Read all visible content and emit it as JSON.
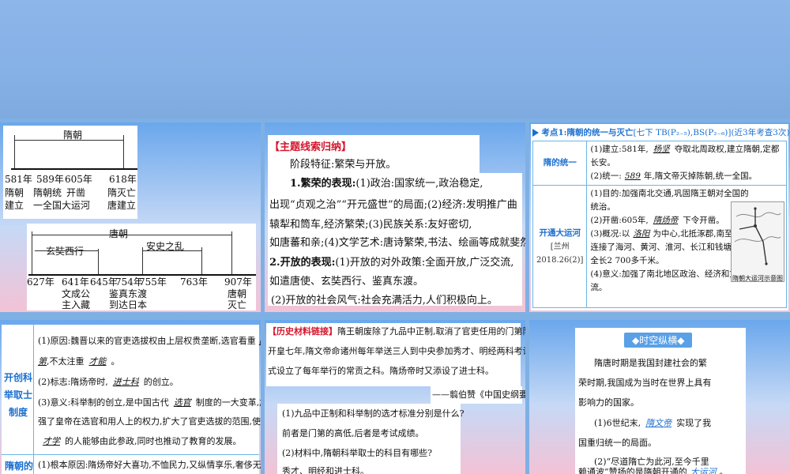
{
  "slide1": {
    "sui_dynasty": "隋朝",
    "tang_dynasty": "唐朝",
    "xuanzang_label": "玄奘西行",
    "anshi_label": "安史之乱",
    "sui_events": [
      {
        "year": "581年",
        "lines": [
          "隋朝",
          "建立"
        ]
      },
      {
        "year": "589年",
        "lines": [
          "隋朝统",
          "一全国"
        ]
      },
      {
        "year": "605年",
        "lines": [
          "开凿",
          "大运河"
        ]
      },
      {
        "year": "618年",
        "lines": [
          "隋灭亡",
          "唐建立"
        ]
      }
    ],
    "tang_events": [
      {
        "year": "627年",
        "lines": []
      },
      {
        "year": "641年",
        "lines": [
          "文成公",
          "主入藏"
        ]
      },
      {
        "year": "645年",
        "lines": []
      },
      {
        "year": "754年",
        "lines": [
          "鉴真东渡",
          "到达日本"
        ]
      },
      {
        "year": "755年",
        "lines": []
      },
      {
        "year": "763年",
        "lines": []
      },
      {
        "year": "907年",
        "lines": [
          "唐朝",
          "灭亡"
        ]
      }
    ]
  },
  "slide2": {
    "title": "【主题线索归纳】",
    "stage": "阶段特征:繁荣与开放。",
    "p1_label": "1.繁荣的表现:",
    "p1_a": "(1)政治:国家统一,政治稳定,",
    "p1_b": "出现“贞观之治”“开元盛世”的局面;(2)经济:发明推广曲",
    "p1_c": "辕犁和筒车,经济繁荣;(3)民族关系:友好密切,",
    "p1_d": "如唐蕃和亲;(4)文学艺术:唐诗繁荣,书法、绘画等成就斐然。",
    "p2_label": "2.开放的表现:",
    "p2_a": "(1)开放的对外政策:全面开放,广泛交流,",
    "p2_b": "如遣唐使、玄奘西行、鉴真东渡。",
    "p2_c": "(2)开放的社会风气:社会充满活力,人们积极向上。"
  },
  "slide3": {
    "header": "考点1:隋朝的统一与灭亡",
    "header_ref": "[七下 TB(P₂₋₅),BS(P₂₋₆)](近3年考查3次)",
    "row1_label": "隋的统一",
    "row1_a1": "(1)建立:581年,",
    "row1_a_blank": "杨坚",
    "row1_a2": "夺取北周政权,建立隋朝,定都长安。",
    "row1_b1": "(2)统一:",
    "row1_b_blank": "589",
    "row1_b2": "年,隋文帝灭掉陈朝,统一全国。",
    "row2_label": "开通大运河",
    "row2_ref": "[兰州2018.26(2)]",
    "row2_1": "(1)目的:加强南北交通,巩固隋王朝对全国的",
    "row2_1b": "统治。",
    "row2_2a": "(2)开凿:605年,",
    "row2_2_blank": "隋炀帝",
    "row2_2b": "下令开凿。",
    "row2_3a": "(3)概况:以",
    "row2_3_blank": "洛阳",
    "row2_3b": "为中心,北抵涿郡,南至余杭,",
    "row2_3c": "连接了海河、黄河、淮河、长江和钱塘江五大水系,",
    "row2_3d": "全长2 700多千米。",
    "row2_4": "(4)意义:加强了南北地区政治、经济和文化交",
    "row2_4b": "流。",
    "map_caption": "隋朝大运河示意图"
  },
  "slide4": {
    "row1_label": "开创科举取士制度",
    "l1a": "(1)原因:魏晋以来的官吏选拔权由上层权贵垄断,选官看重",
    "l1_blank1": "门",
    "l1b_blank": "第",
    "l1b": ",不太注重",
    "l1b_blank2": "才能",
    "l1b_end": "。",
    "l2a": "(2)标志:隋炀帝时,",
    "l2_blank": "进士科",
    "l2b": "的创立。",
    "l3a": "(3)意义:科举制的创立,是中国古代",
    "l3_blank": "选官",
    "l3b": "制度的一大变革,加",
    "l3c": "强了皇帝在选官和用人上的权力,扩大了官吏选拔的范围,使有",
    "l3d_blank": "才学",
    "l3d": "的人能够由此参政,同时也推动了教育的发展。",
    "row2_label": "隋朝的",
    "l4": "(1)根本原因:隋炀帝好大喜功,不恤民力,又纵情享乐,奢侈无"
  },
  "slide5": {
    "title": "【历史材料链接】",
    "t1": "隋王朝废除了九品中正制,取消了官吏任用的门第限制。",
    "t2": "开皇七年,隋文帝命诸州每年举送三人到中央参加秀才、明经两科考试,正",
    "t3": "式设立了每年举行的常贡之科。隋炀帝时又添设了进士科。",
    "src": "——翦伯赞《中国史纲要》",
    "q1": "(1)九品中正制和科举制的选才标准分别是什么?",
    "a1": "前者是门第的高低,后者是考试成绩。",
    "q2": "(2)材料中,隋朝科举取士的科目有哪些?",
    "a2": "秀才、明经和进士科。"
  },
  "slide6": {
    "title": "时空纵横",
    "p1a": "隋唐时期是我国封建社会的繁",
    "p1b": "荣时期,我国成为当时在世界上具有",
    "p1c": "影响力的国家。",
    "p2a": "(1)6世纪末,",
    "p2_blank": "隋文帝",
    "p2b": "实现了我",
    "p2c": "国重归统一的局面。",
    "p3a": "(2)“尽道隋亡为此河,至今千里",
    "p3b": "赖通波”赞扬的是隋朝开通的",
    "p3_blank": "大运河",
    "p3c": "。"
  },
  "colors": {
    "accent_red": "#d4162c",
    "accent_blue": "#1b6fcf",
    "border_blue": "#6ab6e6"
  }
}
